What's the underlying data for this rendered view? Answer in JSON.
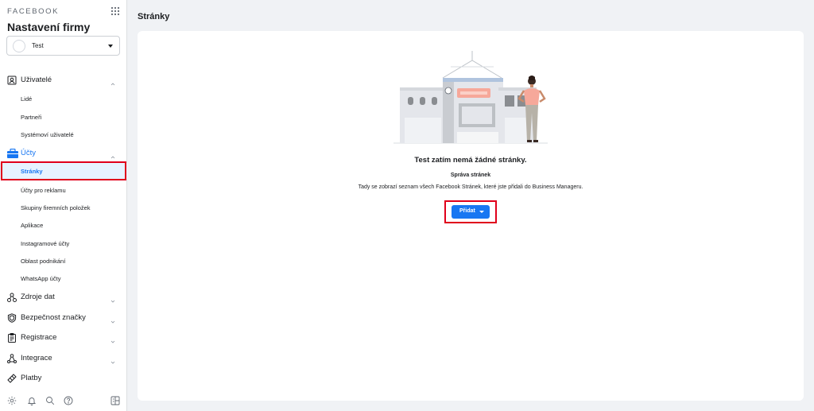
{
  "brand": "FACEBOOK",
  "business": {
    "title": "Nastavení firmy",
    "selected_name": "Test"
  },
  "sidebar": {
    "users": {
      "label": "Uživatelé",
      "items": [
        "Lidé",
        "Partneři",
        "Systémoví uživatelé"
      ]
    },
    "accounts": {
      "label": "Účty",
      "items": [
        "Stránky",
        "Účty pro reklamu",
        "Skupiny firemních položek",
        "Aplikace",
        "Instagramové účty",
        "Oblast podnikání",
        "WhatsApp účty"
      ],
      "active_item": "Stránky"
    },
    "sections": [
      "Zdroje dat",
      "Bezpečnost značky",
      "Registrace",
      "Integrace",
      "Platby"
    ]
  },
  "header": {
    "title": "Stránky"
  },
  "empty_state": {
    "title": "Test zatím nemá žádné stránky.",
    "subtitle": "Správa stránek",
    "description": "Tady se zobrazí seznam všech Facebook Stránek, které jste přidali do Business Manageru.",
    "button_label": "Přidat"
  },
  "colors": {
    "accent": "#1877f2",
    "active_bg": "#e7f3ff",
    "highlight": "#e0001b"
  },
  "icons": [
    "apps-grid-icon",
    "users-icon",
    "briefcase-icon",
    "data-sources-icon",
    "shield-icon",
    "clipboard-icon",
    "integrations-icon",
    "payments-icon",
    "settings-icon",
    "bell-icon",
    "search-icon",
    "help-icon",
    "panel-icon"
  ]
}
